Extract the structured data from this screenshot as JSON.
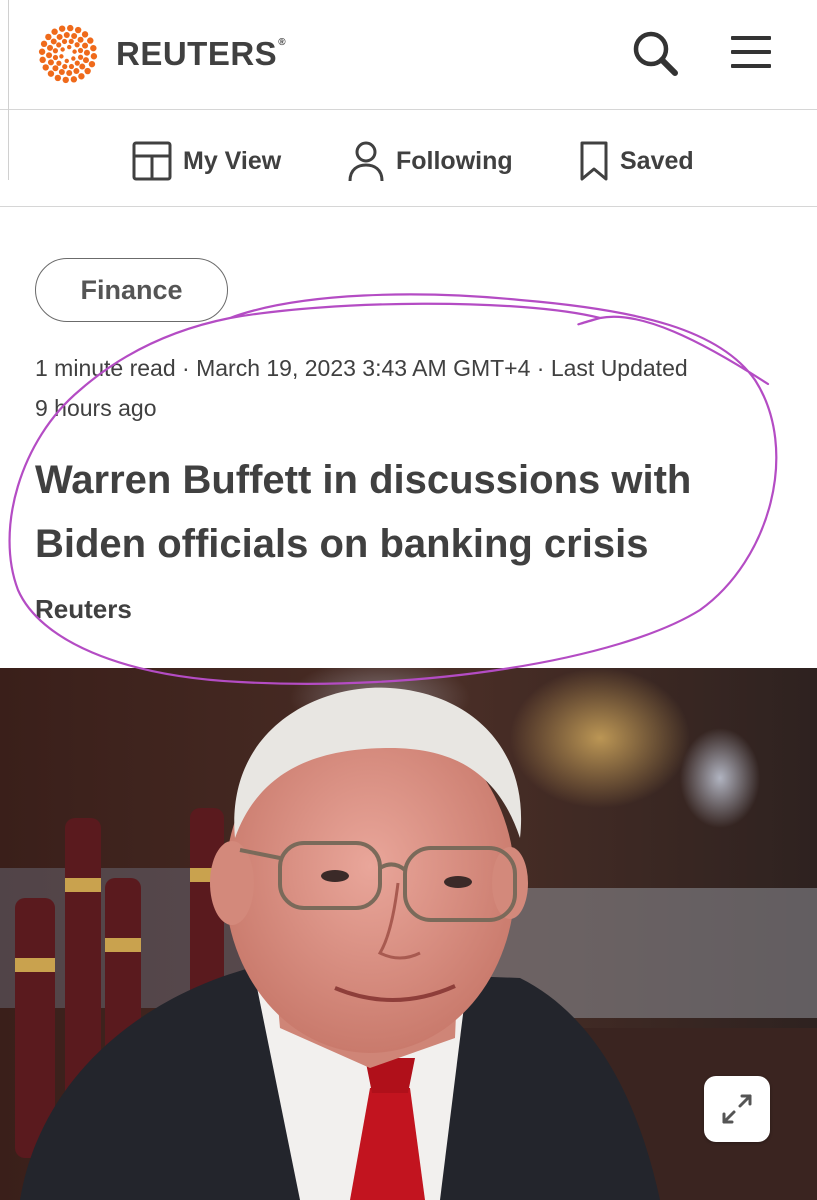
{
  "brand": {
    "name": "REUTERS",
    "registered": "®",
    "logo_icon": "reuters-dot-sphere-logo",
    "accent_color": "#ef6a1b"
  },
  "header": {
    "search_icon": "search-icon",
    "menu_icon": "hamburger-menu-icon"
  },
  "subnav": {
    "items": [
      {
        "label": "My View",
        "icon": "layout-grid-icon"
      },
      {
        "label": "Following",
        "icon": "person-icon"
      },
      {
        "label": "Saved",
        "icon": "bookmark-icon"
      }
    ]
  },
  "article": {
    "category": "Finance",
    "meta_line1": "1 minute read · March 19, 2023 3:43 AM GMT+4 · Last Updated",
    "meta_line2": "9 hours ago",
    "headline_line1": "Warren Buffett in discussions with",
    "headline_line2": "Biden officials on banking crisis",
    "byline": "Reuters",
    "image_icon": "expand-arrows-icon"
  },
  "annotation_color": "#b44cc4"
}
